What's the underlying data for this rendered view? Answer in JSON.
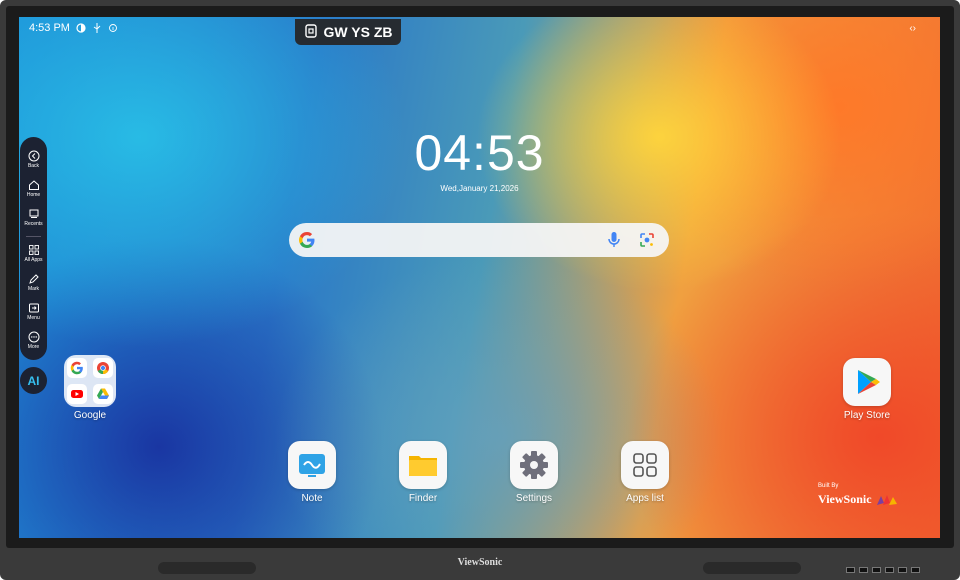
{
  "status_bar": {
    "time": "4:53 PM"
  },
  "badge": {
    "code": "GW YS ZB"
  },
  "clock": {
    "time": "04:53",
    "date": "Wed,January 21,2026"
  },
  "sidebar": {
    "items": [
      {
        "label": "Back",
        "icon": "back-icon"
      },
      {
        "label": "Home",
        "icon": "home-icon"
      },
      {
        "label": "Recents",
        "icon": "recents-icon"
      },
      {
        "label": "All Apps",
        "icon": "all-apps-icon"
      },
      {
        "label": "Mark",
        "icon": "mark-icon"
      },
      {
        "label": "Menu",
        "icon": "menu-icon"
      },
      {
        "label": "More",
        "icon": "more-icon"
      }
    ],
    "ai_label": "AI"
  },
  "folder": {
    "label": "Google"
  },
  "play_store": {
    "label": "Play Store"
  },
  "dock": {
    "items": [
      {
        "label": "Note",
        "icon": "note-icon"
      },
      {
        "label": "Finder",
        "icon": "finder-icon"
      },
      {
        "label": "Settings",
        "icon": "settings-icon"
      },
      {
        "label": "Apps list",
        "icon": "apps-list-icon"
      }
    ]
  },
  "branding": {
    "built_by": "Built By",
    "name": "ViewSonic"
  },
  "bezel": {
    "logo": "ViewSonic"
  },
  "colors": {
    "sidebar_bg": "#1c2232",
    "ai_accent": "#36c0f0",
    "bezel": "#3a3a3a"
  }
}
